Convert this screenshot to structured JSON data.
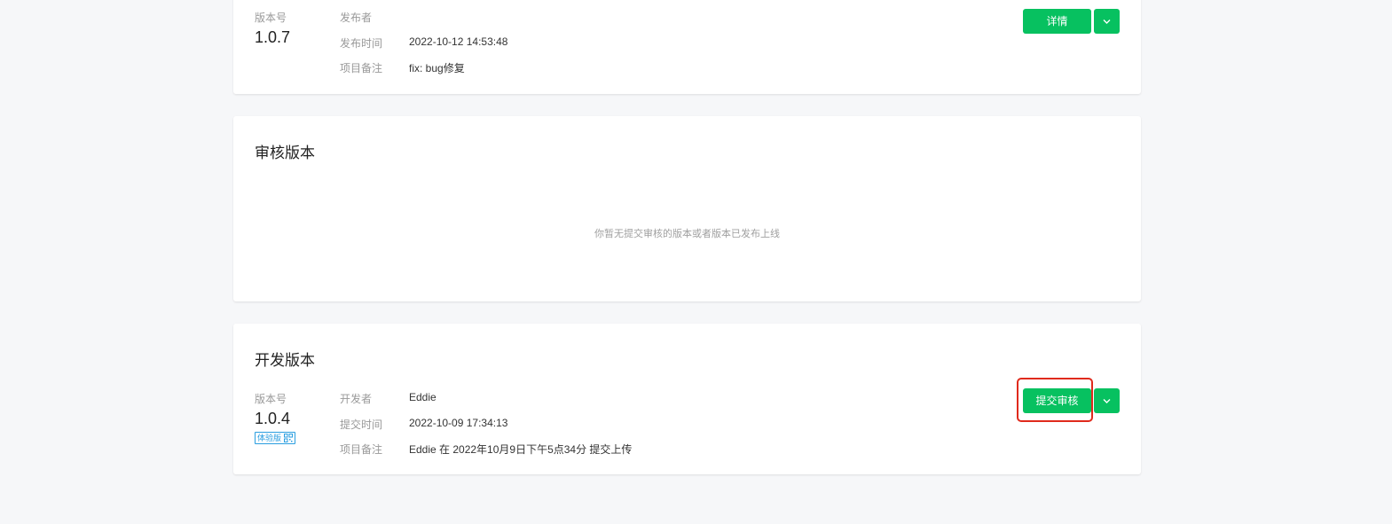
{
  "released": {
    "version_label": "版本号",
    "version": "1.0.7",
    "publisher_label": "发布者",
    "publisher": "",
    "publish_time_label": "发布时间",
    "publish_time": "2022-10-12 14:53:48",
    "remark_label": "项目备注",
    "remark": "fix: bug修复",
    "details_button": "详情",
    "dropdown_icon": "chevron-down-icon"
  },
  "review": {
    "title": "审核版本",
    "empty_text": "你暂无提交审核的版本或者版本已发布上线"
  },
  "dev": {
    "title": "开发版本",
    "version_label": "版本号",
    "version": "1.0.4",
    "experience_tag": "体验版",
    "qr_icon": "qr-code-icon",
    "developer_label": "开发者",
    "developer": "Eddie",
    "submit_time_label": "提交时间",
    "submit_time": "2022-10-09 17:34:13",
    "remark_label": "项目备注",
    "remark": "Eddie 在 2022年10月9日下午5点34分 提交上传",
    "submit_review_button": "提交审核",
    "dropdown_icon": "chevron-down-icon"
  },
  "colors": {
    "primary_green": "#07c160",
    "highlight_red": "#e02a1c",
    "tag_blue": "#2a9ee0",
    "page_background": "#f6f7f9"
  }
}
